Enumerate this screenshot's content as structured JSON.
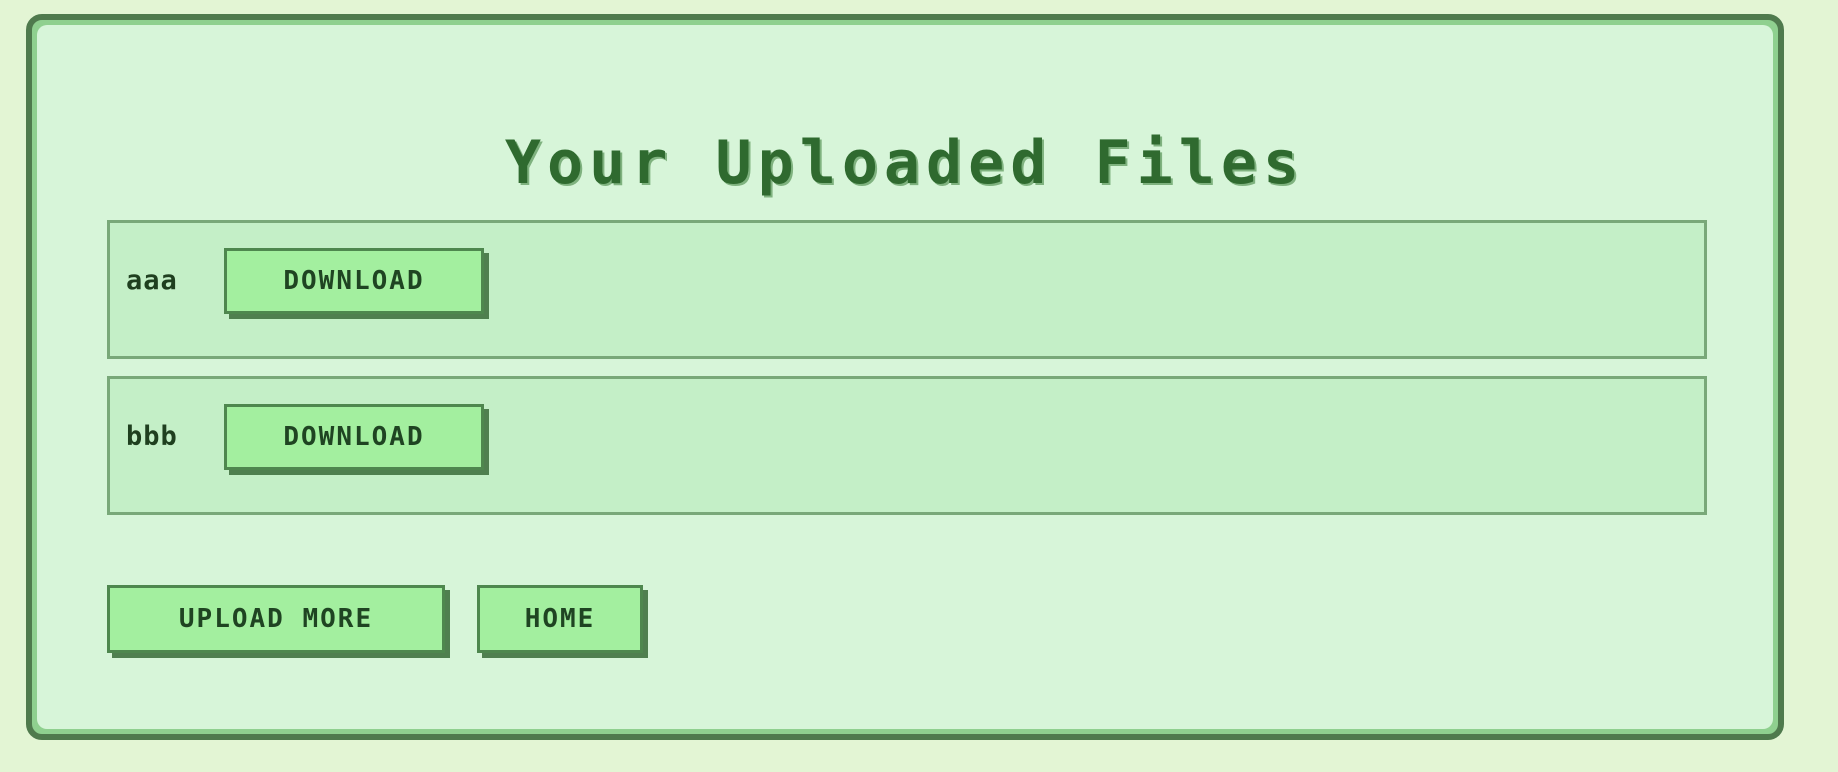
{
  "page": {
    "title": "Your Uploaded Files"
  },
  "files": [
    {
      "name": "aaa",
      "download_label": "DOWNLOAD"
    },
    {
      "name": "bbb",
      "download_label": "DOWNLOAD"
    }
  ],
  "actions": {
    "upload_more_label": "UPLOAD MORE",
    "home_label": "HOME"
  },
  "colors": {
    "background": "#e3f5d4",
    "panel": "#d7f5d9",
    "panel_border": "#4f7a4d",
    "row_background": "#c4efc7",
    "button": "#a3ef9f",
    "title_text": "#2f6a2f"
  }
}
